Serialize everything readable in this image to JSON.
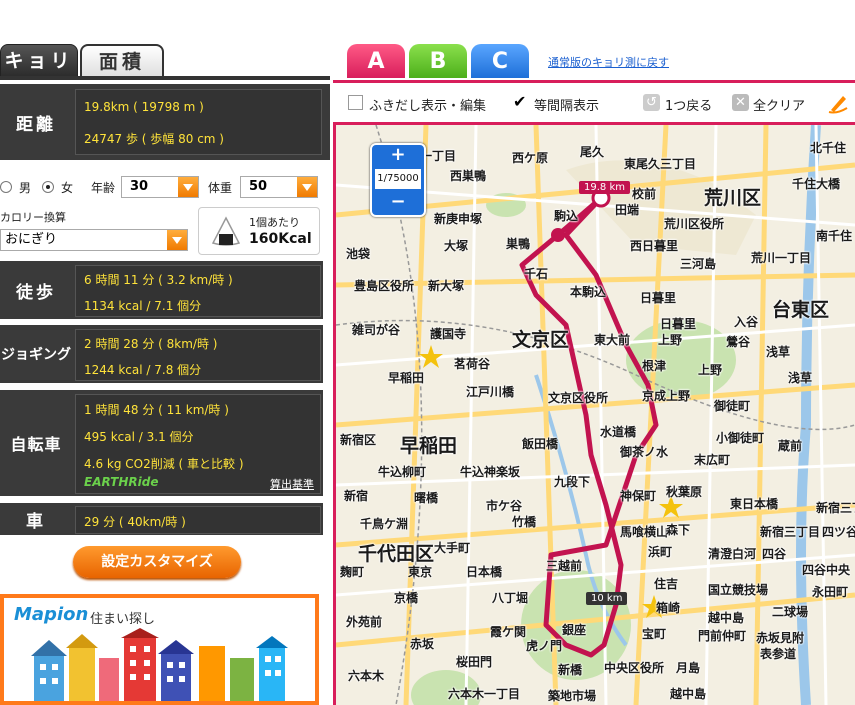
{
  "left_tabs": [
    "キョリ",
    "面積"
  ],
  "distance": {
    "label": "距離",
    "line1": "19.8km ( 19798 m )",
    "line2": "24747 歩 ( 歩幅 80 cm )"
  },
  "profile": {
    "male_label": "男",
    "female_label": "女",
    "age_label": "年齢",
    "age_value": "30",
    "weight_label": "体重",
    "weight_value": "50",
    "calorie_label": "カロリー換算",
    "food_value": "おにぎり",
    "per_unit_label": "1個あたり",
    "kcal_value": "160Kcal"
  },
  "walk": {
    "label": "徒歩",
    "line1": "6 時間 11 分 ( 3.2 km/時 )",
    "line2": "1134 kcal / 7.1 個分"
  },
  "jog": {
    "label": "ジョギング",
    "line1": "2 時間 28 分 ( 8km/時 )",
    "line2": "1244 kcal / 7.8 個分"
  },
  "bike": {
    "label": "自転車",
    "line1": "1 時間 48 分 ( 11 km/時 )",
    "line2": "495 kcal / 3.1 個分",
    "line3": "4.6 kg CO2削減 ( 車と比較 )",
    "earth_logo": "EARTHRide",
    "calc_link": "算出基準"
  },
  "car": {
    "label": "車",
    "line1": "29 分 ( 40km/時 )"
  },
  "customize_button": "設定カスタマイズ",
  "banner": {
    "brand": "Mapion",
    "text": "住まい探し"
  },
  "map_tabs": [
    "A",
    "B",
    "C"
  ],
  "back_link": "通常版のキョリ測に戻す",
  "toolbar": {
    "balloon_label": "ふきだし表示・編集",
    "interval_label": "等間隔表示",
    "undo_label": "1つ戻る",
    "clear_label": "全クリア"
  },
  "zoom": {
    "plus": "+",
    "scale": "1/75000",
    "minus": "−"
  },
  "map": {
    "distance_badge": "19.8 km",
    "marker_10km": "10 km",
    "labels": [
      "野川一丁目",
      "西ケ原",
      "尾久",
      "東尾久三丁目",
      "北千住",
      "千住大橋",
      "荒川区",
      "西巣鴨",
      "校前",
      "田端",
      "荒川区役所",
      "南千住",
      "新庚申塚",
      "駒込",
      "西日暮里",
      "三河島",
      "荒川一丁目",
      "池袋",
      "大塚",
      "巣鴨",
      "千石",
      "本駒込",
      "日暮里",
      "台東区",
      "豊島区役所",
      "新大塚",
      "日暮里",
      "入谷",
      "雑司が谷",
      "護国寺",
      "文京区",
      "東大前",
      "上野",
      "鶯谷",
      "浅草",
      "茗荷谷",
      "根津",
      "上野",
      "浅草",
      "早稲田",
      "江戸川橋",
      "文京区役所",
      "京成上野",
      "御徒町",
      "新宿区",
      "早稲田",
      "飯田橋",
      "水道橋",
      "小御徒町",
      "蔵前",
      "牛込柳町",
      "牛込神楽坂",
      "御茶ノ水",
      "末広町",
      "新宿",
      "曙橋",
      "市ケ谷",
      "九段下",
      "神保町",
      "秋葉原",
      "東日本橋",
      "新宿三丁目",
      "千鳥ケ淵",
      "竹橋",
      "馬喰横山",
      "森下",
      "新宿三丁目",
      "四ツ谷",
      "千代田区",
      "大手町",
      "三越前",
      "浜町",
      "清澄白河",
      "四谷",
      "四谷中央",
      "麹町",
      "東京",
      "日本橋",
      "住吉",
      "国立競技場",
      "永田町",
      "京橋",
      "八丁堀",
      "箱崎",
      "越中島",
      "二球場",
      "外苑前",
      "赤坂",
      "霞ケ関",
      "銀座",
      "宝町",
      "門前仲町",
      "赤坂見附",
      "桜田門",
      "虎ノ門",
      "新橋",
      "中央区役所",
      "月島",
      "表参道",
      "六本木",
      "六本木一丁目",
      "築地市場",
      "越中島"
    ]
  }
}
